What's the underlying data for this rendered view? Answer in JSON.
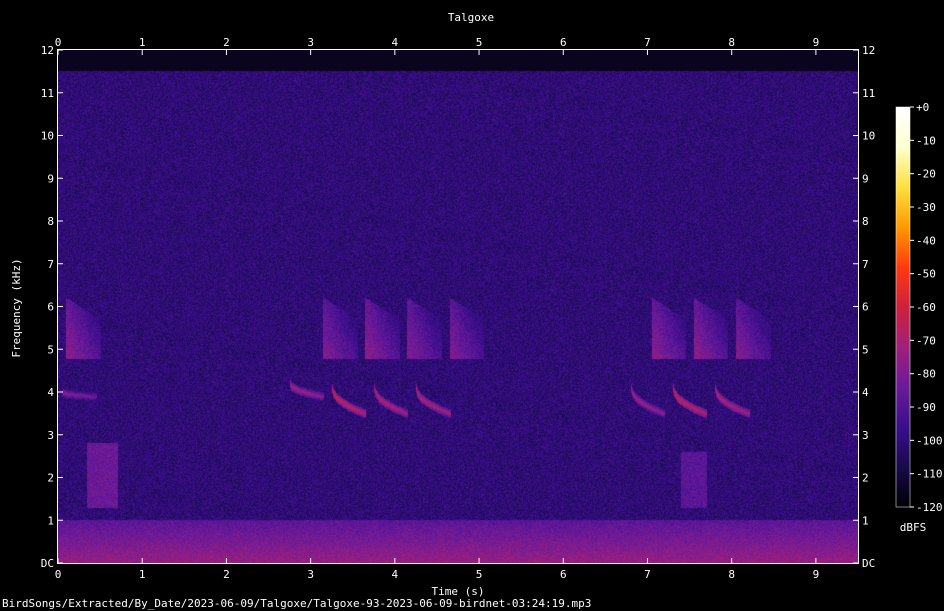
{
  "chart_data": {
    "type": "heatmap",
    "title": "Talgoxe",
    "xlabel": "Time (s)",
    "ylabel": "Frequency (kHz)",
    "xlim": [
      0,
      9.5
    ],
    "ylim": [
      0,
      12
    ],
    "x_ticks": [
      "0",
      "1",
      "2",
      "3",
      "4",
      "5",
      "6",
      "7",
      "8",
      "9"
    ],
    "y_ticks": [
      "DC",
      "1",
      "2",
      "3",
      "4",
      "5",
      "6",
      "7",
      "8",
      "9",
      "10",
      "11",
      "12"
    ],
    "colorbar": {
      "label": "dBFS",
      "ticks": [
        "+0",
        "-10",
        "-20",
        "-30",
        "-40",
        "-50",
        "-60",
        "-70",
        "-80",
        "-90",
        "-100",
        "-110",
        "-120"
      ],
      "range": [
        -120,
        0
      ],
      "colors": [
        "#000000",
        "#180a4a",
        "#3a0e8c",
        "#6a1a9a",
        "#a0207a",
        "#d0203a",
        "#ff3a10",
        "#ff9a00",
        "#ffe040",
        "#ffffd0",
        "#ffffff"
      ]
    },
    "background_level_dbfs": -100,
    "upper_cutoff_khz": 11.5,
    "low_freq_band": {
      "from_khz": 0,
      "to_khz": 1,
      "level_dbfs": -78
    },
    "calls": [
      {
        "time_s": 0.1,
        "start_khz": 6.2,
        "end_khz": 4.9,
        "level_dbfs": -72
      },
      {
        "time_s": 3.15,
        "start_khz": 6.2,
        "end_khz": 4.9,
        "level_dbfs": -74
      },
      {
        "time_s": 3.65,
        "start_khz": 6.2,
        "end_khz": 4.9,
        "level_dbfs": -72
      },
      {
        "time_s": 4.15,
        "start_khz": 6.2,
        "end_khz": 4.9,
        "level_dbfs": -74
      },
      {
        "time_s": 4.65,
        "start_khz": 6.2,
        "end_khz": 4.9,
        "level_dbfs": -74
      },
      {
        "time_s": 7.05,
        "start_khz": 6.2,
        "end_khz": 4.9,
        "level_dbfs": -72
      },
      {
        "time_s": 7.55,
        "start_khz": 6.2,
        "end_khz": 4.9,
        "level_dbfs": -72
      },
      {
        "time_s": 8.05,
        "start_khz": 6.2,
        "end_khz": 4.9,
        "level_dbfs": -74
      },
      {
        "time_s": 0.05,
        "start_khz": 4.0,
        "end_khz": 3.9,
        "level_dbfs": -76
      },
      {
        "time_s": 2.75,
        "start_khz": 4.2,
        "end_khz": 3.9,
        "level_dbfs": -70
      },
      {
        "time_s": 3.25,
        "start_khz": 4.1,
        "end_khz": 3.5,
        "level_dbfs": -62
      },
      {
        "time_s": 3.75,
        "start_khz": 4.1,
        "end_khz": 3.5,
        "level_dbfs": -66
      },
      {
        "time_s": 4.25,
        "start_khz": 4.1,
        "end_khz": 3.5,
        "level_dbfs": -66
      },
      {
        "time_s": 6.8,
        "start_khz": 4.1,
        "end_khz": 3.5,
        "level_dbfs": -70
      },
      {
        "time_s": 7.3,
        "start_khz": 4.1,
        "end_khz": 3.5,
        "level_dbfs": -62
      },
      {
        "time_s": 7.8,
        "start_khz": 4.1,
        "end_khz": 3.5,
        "level_dbfs": -66
      }
    ],
    "faint_patches": [
      {
        "time_from_s": 0.35,
        "time_to_s": 0.7,
        "from_khz": 1.3,
        "to_khz": 2.8,
        "level_dbfs": -84
      },
      {
        "time_from_s": 7.4,
        "time_to_s": 7.7,
        "from_khz": 1.3,
        "to_khz": 2.6,
        "level_dbfs": -88
      }
    ]
  },
  "file_path": "BirdSongs/Extracted/By_Date/2023-06-09/Talgoxe/Talgoxe-93-2023-06-09-birdnet-03:24:19.mp3"
}
